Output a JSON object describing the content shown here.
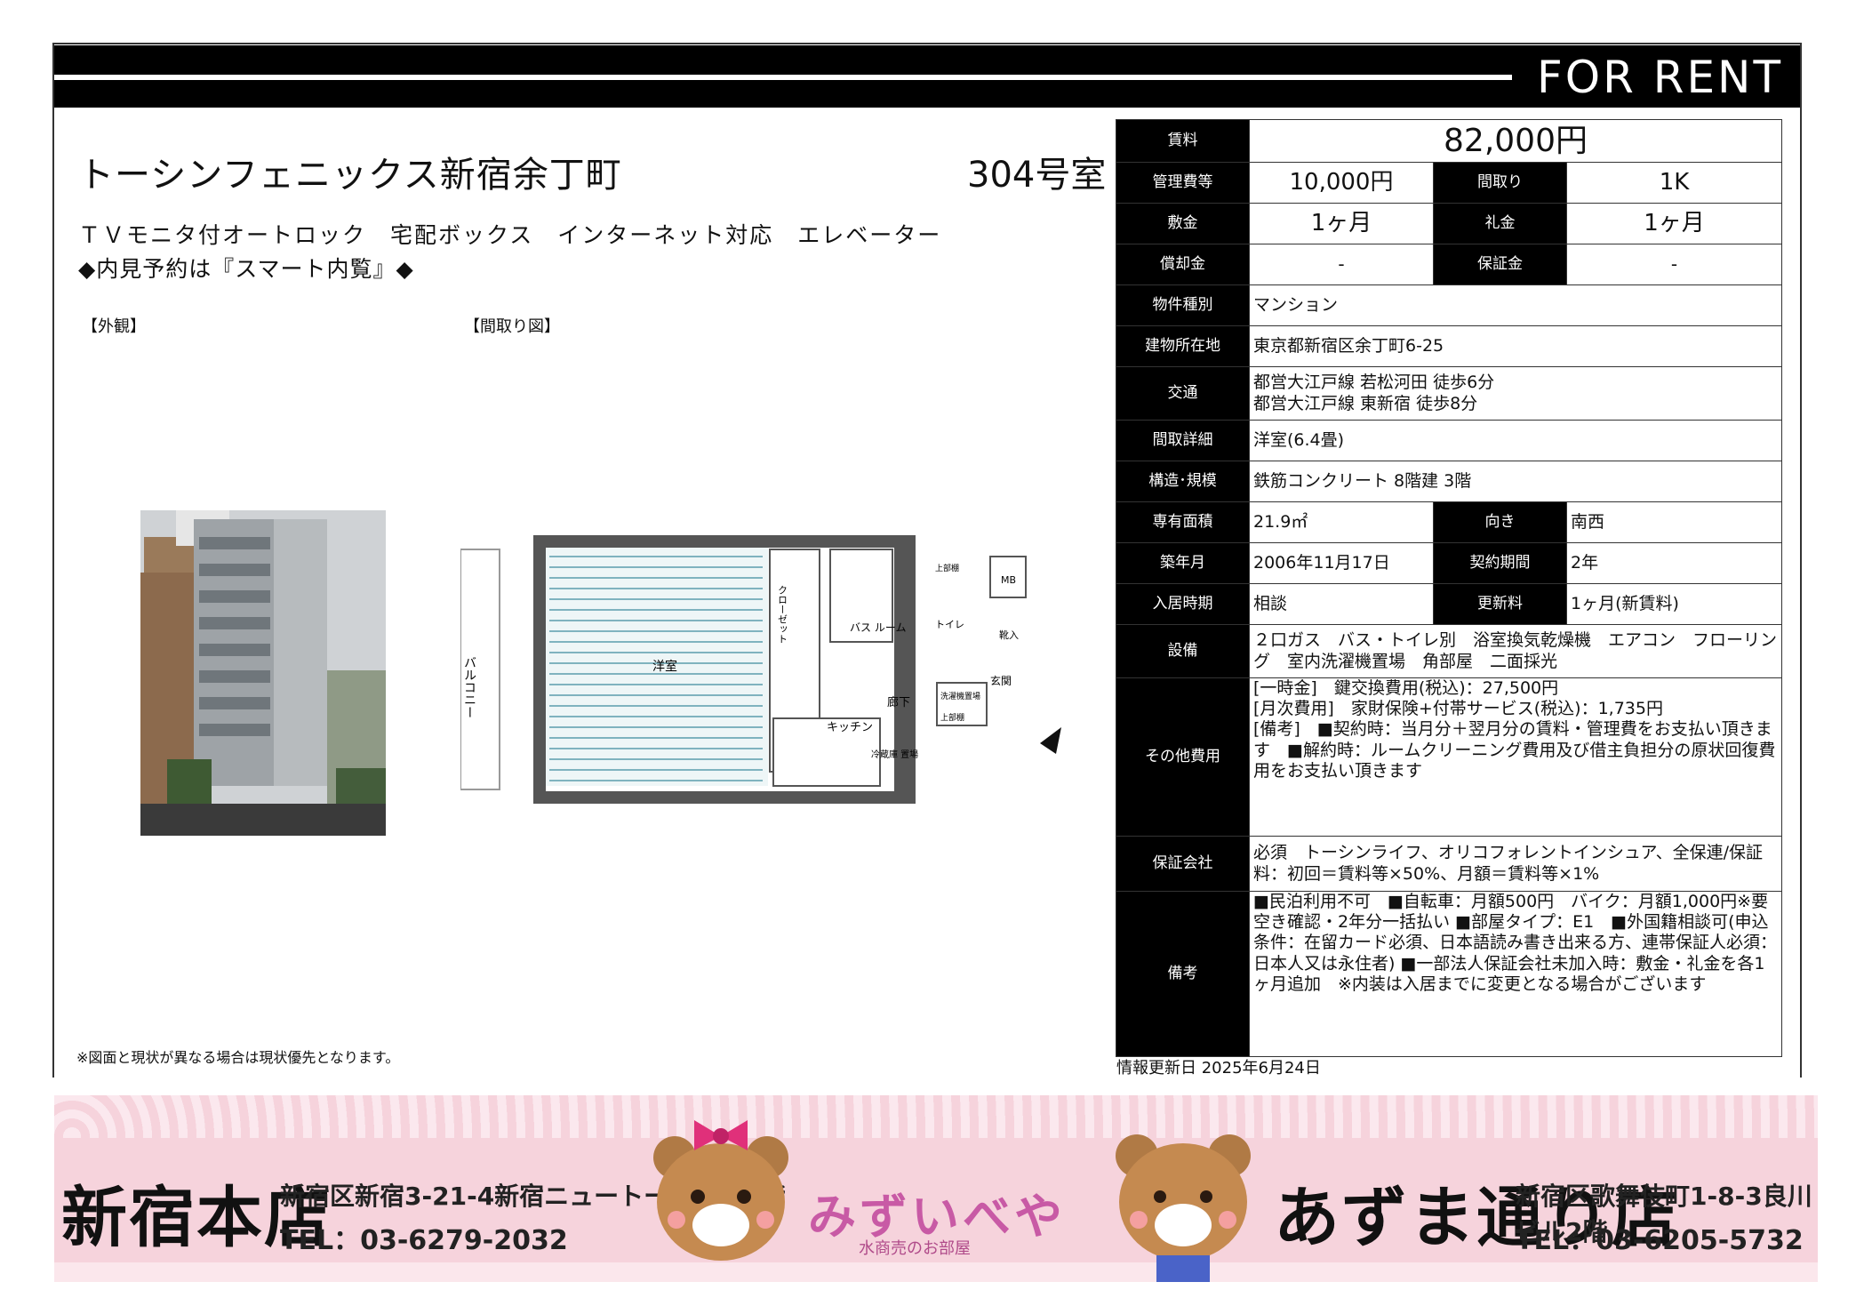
{
  "header": {
    "for_rent": "FOR RENT"
  },
  "property": {
    "name": "トーシンフェニックス新宿余丁町",
    "room": "304号室",
    "features": "ＴＶモニタ付オートロック　宅配ボックス　インターネット対応　エレベーター",
    "viewing": "◆内見予約は『スマート内覧』◆"
  },
  "images": {
    "exterior_label": "【外観】",
    "plan_label": "【間取り図】"
  },
  "floorplan_labels": {
    "balcony": "バルコニー",
    "western": "洋室",
    "closet": "クローゼット",
    "bath": "バス\nルーム",
    "toilet": "トイレ",
    "upper": "上部棚",
    "mb": "MB",
    "shoe": "靴入",
    "entrance": "玄関",
    "hall": "廊下",
    "kitchen": "キッチン",
    "fridge": "冷蔵庫\n置場",
    "washer": "洗濯機置場",
    "upper2": "上部棚"
  },
  "note": "※図面と現状が異なる場合は現状優先となります。",
  "spec": {
    "rent_label": "賃料",
    "rent": "82,000円",
    "fee_label": "管理費等",
    "fee": "10,000円",
    "layout_label": "間取り",
    "layout": "1K",
    "deposit_label": "敷金",
    "deposit": "1ヶ月",
    "key_money_label": "礼金",
    "key_money": "1ヶ月",
    "amort_label": "償却金",
    "amort": "-",
    "guarantee_label": "保証金",
    "guarantee": "-",
    "type_label": "物件種別",
    "type": "マンション",
    "address_label": "建物所在地",
    "address": "東京都新宿区余丁町6-25",
    "transport_label": "交通",
    "transport1": "都営大江戸線 若松河田 徒歩6分",
    "transport2": "都営大江戸線 東新宿 徒歩8分",
    "detail_label": "間取詳細",
    "detail": "洋室(6.4畳)",
    "structure_label": "構造･規模",
    "structure": "鉄筋コンクリート 8階建 3階",
    "area_label": "専有面積",
    "area": "21.9㎡",
    "direction_label": "向き",
    "direction": "南西",
    "built_label": "築年月",
    "built": "2006年11月17日",
    "contract_label": "契約期間",
    "contract": "2年",
    "movein_label": "入居時期",
    "movein": "相談",
    "renewal_label": "更新料",
    "renewal": "1ヶ月(新賃料)",
    "equip_label": "設備",
    "equip": "２口ガス　バス・トイレ別　浴室換気乾燥機　エアコン　フローリング　室内洗濯機置場　角部屋　二面採光",
    "other_label": "その他費用",
    "other1": "[一時金]　鍵交換費用(税込)：27,500円",
    "other2": "[月次費用]　家財保険+付帯サービス(税込)：1,735円",
    "other3": "[備考]　■契約時：当月分＋翌月分の賃料・管理費をお支払い頂きます　■解約時：ルームクリーニング費用及び借主負担分の原状回復費用をお支払い頂きます",
    "guarantor_label": "保証会社",
    "guarantor": "必須　トーシンライフ、オリコフォレントインシュア、全保連/保証料：初回＝賃料等×50%、月額＝賃料等×1%",
    "remarks_label": "備考",
    "remarks": "■民泊利用不可　■自転車：月額500円　バイク：月額1,000円※要空き確認・2年分一括払い ■部屋タイプ：E1　■外国籍相談可(申込条件：在留カード必須、日本語読み書き出来る方、連帯保証人必須：日本人又は永住者) ■一部法人保証会社未加入時：敷金・礼金を各1ヶ月追加　※内装は入居までに変更となる場合がございます"
  },
  "updated": "情報更新日 2025年6月24日",
  "banner": {
    "shop1": "新宿本店",
    "addr1": "新宿区新宿3-21-4新宿ニュートーワビル1階",
    "tel1": "TEL：03-6279-2032",
    "logo": "みずいべや",
    "logo_sub": "水商売のお部屋",
    "shop2": "あずま通り店",
    "addr2": "新宿区歌舞伎町1-8-3良川ビル2階",
    "tel2": "TEL：03-6205-5732"
  }
}
